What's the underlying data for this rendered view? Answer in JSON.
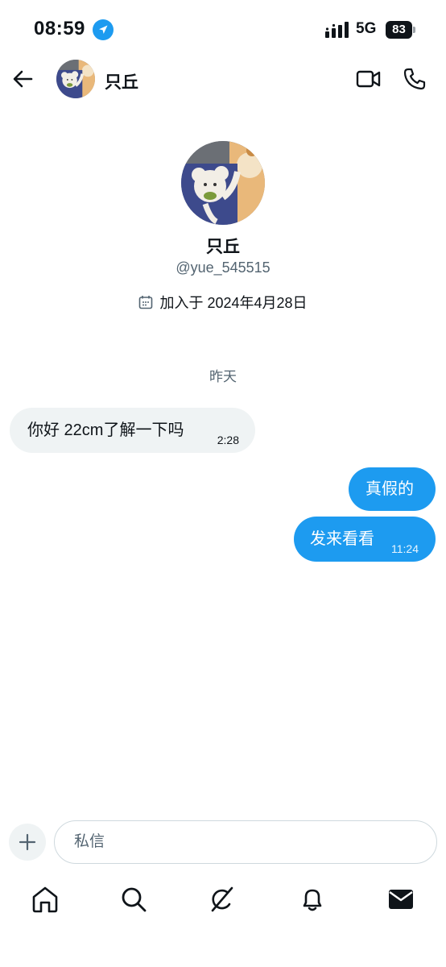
{
  "status_bar": {
    "time": "08:59",
    "network": "5G",
    "battery": "83"
  },
  "header": {
    "name": "只丘",
    "icons": [
      "back-arrow-icon",
      "video-call-icon",
      "phone-call-icon"
    ]
  },
  "profile": {
    "name": "只丘",
    "handle": "@yue_545515",
    "joined": "加入于 2024年4月28日"
  },
  "date_divider": "昨天",
  "messages": [
    {
      "direction": "incoming",
      "text": "你好 22cm了解一下吗",
      "time": "2:28"
    },
    {
      "direction": "outgoing",
      "text": "真假的",
      "time": ""
    },
    {
      "direction": "outgoing",
      "text": "发来看看",
      "time": "11:24"
    }
  ],
  "composer": {
    "placeholder": "私信"
  },
  "bottom_nav": [
    "home-icon",
    "search-icon",
    "grok-icon",
    "notifications-icon",
    "messages-icon"
  ],
  "colors": {
    "accent": "#1d9bf0",
    "incoming_bubble": "#eff3f4",
    "text": "#0f1419",
    "secondary_text": "#536471"
  }
}
